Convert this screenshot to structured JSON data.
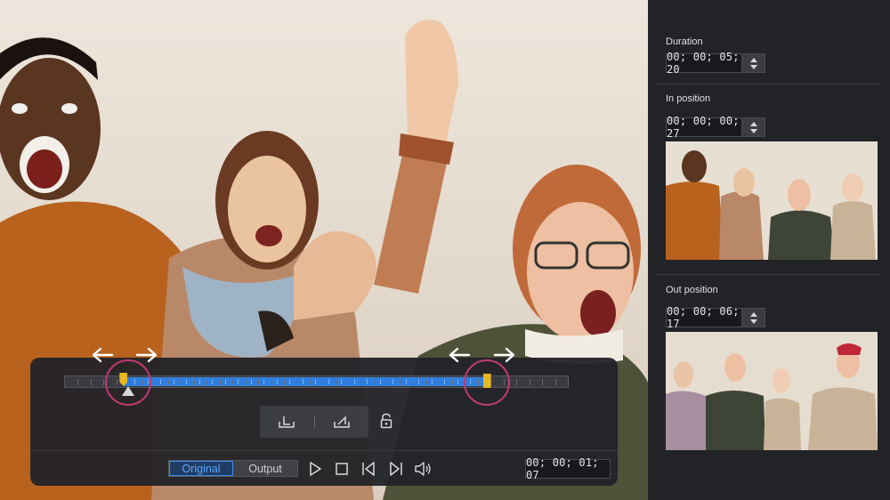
{
  "player": {
    "current_time": "00; 00; 01; 07",
    "mode_tabs": [
      "Original",
      "Output"
    ],
    "active_mode": "Original"
  },
  "trim": {
    "in_fraction": 0.117,
    "out_fraction": 0.837,
    "playhead_fraction": 0.127
  },
  "side": {
    "duration_label": "Duration",
    "duration_value": "00; 00; 05; 20",
    "in_label": "In position",
    "in_value": "00; 00; 00; 27",
    "out_label": "Out position",
    "out_value": "00; 00; 06; 17"
  },
  "colors": {
    "accent_blue": "#2f7fe0",
    "marker_yellow": "#e8b820",
    "highlight_pink": "#c43a73"
  },
  "icons": [
    "play-icon",
    "stop-icon",
    "previous-frame-icon",
    "next-frame-icon",
    "volume-icon",
    "mark-in-icon",
    "mark-out-icon",
    "lock-icon",
    "arrow-left-icon",
    "arrow-right-icon"
  ]
}
